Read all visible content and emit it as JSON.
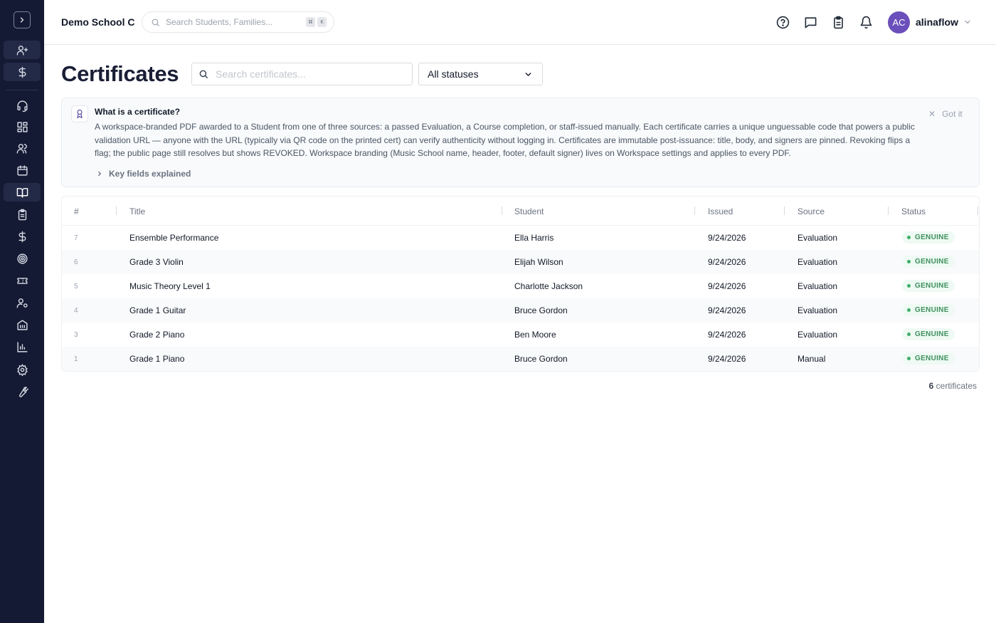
{
  "header": {
    "school_name": "Demo School C",
    "search_placeholder": "Search Students, Families...",
    "shortcut_keys": [
      "⌘",
      "K"
    ],
    "user": {
      "initials": "AC",
      "name": "alinaflow"
    }
  },
  "sidebar": {
    "items": [
      {
        "icon": "user-plus-icon"
      },
      {
        "icon": "dollar-icon"
      },
      {
        "icon": "headset-icon"
      },
      {
        "icon": "dashboard-grid-icon"
      },
      {
        "icon": "users-icon"
      },
      {
        "icon": "calendar-icon"
      },
      {
        "icon": "book-open-icon",
        "active": true
      },
      {
        "icon": "clipboard-icon"
      },
      {
        "icon": "dollar-icon"
      },
      {
        "icon": "target-icon"
      },
      {
        "icon": "ticket-icon"
      },
      {
        "icon": "user-settings-icon"
      },
      {
        "icon": "building-icon"
      },
      {
        "icon": "bar-chart-icon"
      },
      {
        "icon": "gear-icon"
      },
      {
        "icon": "wrench-icon"
      }
    ]
  },
  "page": {
    "title": "Certificates",
    "search_placeholder": "Search certificates...",
    "status_filter": "All statuses"
  },
  "info": {
    "title": "What is a certificate?",
    "body": "A workspace-branded PDF awarded to a Student from one of three sources: a passed Evaluation, a Course completion, or staff-issued manually. Each certificate carries a unique unguessable code that powers a public validation URL — anyone with the URL (typically via QR code on the printed cert) can verify authenticity without logging in. Certificates are immutable post-issuance: title, body, and signers are pinned. Revoking flips a flag; the public page still resolves but shows REVOKED. Workspace branding (Music School name, header, footer, default signer) lives on Workspace settings and applies to every PDF.",
    "dismiss_label": "Got it",
    "key_fields_label": "Key fields explained"
  },
  "table": {
    "columns": [
      "#",
      "Title",
      "Student",
      "Issued",
      "Source",
      "Status"
    ],
    "rows": [
      {
        "num": "7",
        "title": "Ensemble Performance",
        "student": "Ella Harris",
        "issued": "9/24/2026",
        "source": "Evaluation",
        "status": "GENUINE"
      },
      {
        "num": "6",
        "title": "Grade 3 Violin",
        "student": "Elijah Wilson",
        "issued": "9/24/2026",
        "source": "Evaluation",
        "status": "GENUINE"
      },
      {
        "num": "5",
        "title": "Music Theory Level 1",
        "student": "Charlotte Jackson",
        "issued": "9/24/2026",
        "source": "Evaluation",
        "status": "GENUINE"
      },
      {
        "num": "4",
        "title": "Grade 1 Guitar",
        "student": "Bruce Gordon",
        "issued": "9/24/2026",
        "source": "Evaluation",
        "status": "GENUINE"
      },
      {
        "num": "3",
        "title": "Grade 2 Piano",
        "student": "Ben Moore",
        "issued": "9/24/2026",
        "source": "Evaluation",
        "status": "GENUINE"
      },
      {
        "num": "1",
        "title": "Grade 1 Piano",
        "student": "Bruce Gordon",
        "issued": "9/24/2026",
        "source": "Manual",
        "status": "GENUINE"
      }
    ]
  },
  "footer": {
    "count": "6",
    "count_label": " certificates"
  },
  "colors": {
    "sidebar_bg": "#141a33",
    "avatar_bg": "#6b4fbb",
    "status_genuine": "#3f8f5f",
    "title": "#1a1f36"
  }
}
